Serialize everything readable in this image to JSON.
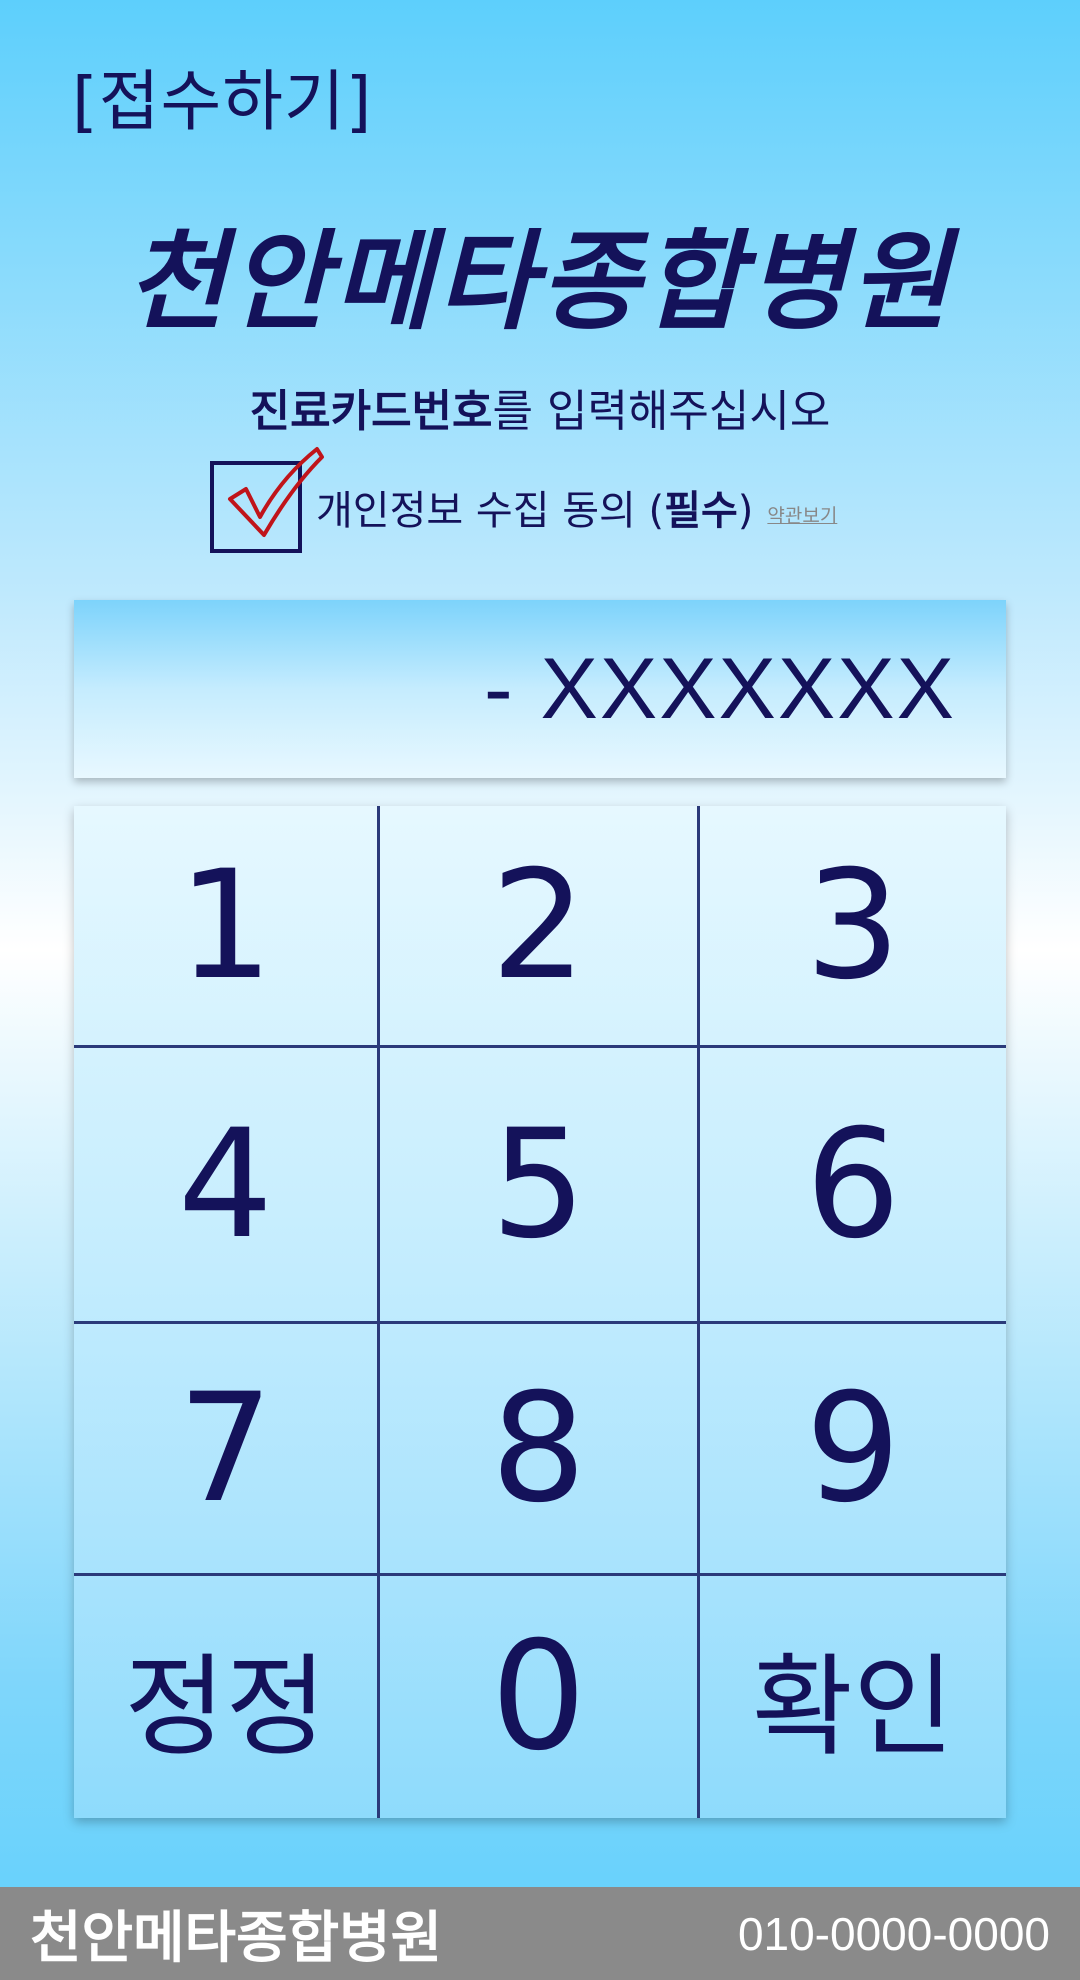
{
  "page_label": "[접수하기]",
  "hospital_title": "천안메타종합병원",
  "instruction": {
    "bold": "진료카드번호",
    "rest": "를 입력해주십시오"
  },
  "consent": {
    "checked": true,
    "label_prefix": "개인정보 수집 동의 (",
    "label_bold": "필수",
    "label_suffix": ")",
    "terms_link": "약관보기"
  },
  "display_value": "- XXXXXXX",
  "keypad": {
    "keys": [
      "1",
      "2",
      "3",
      "4",
      "5",
      "6",
      "7",
      "8",
      "9",
      "정정",
      "0",
      "확인"
    ]
  },
  "footer": {
    "name": "천안메타종합병원",
    "phone": "010-0000-0000"
  },
  "colors": {
    "text": "#14125a",
    "check": "#c0141a",
    "footer_bg": "#8a8a8a"
  }
}
